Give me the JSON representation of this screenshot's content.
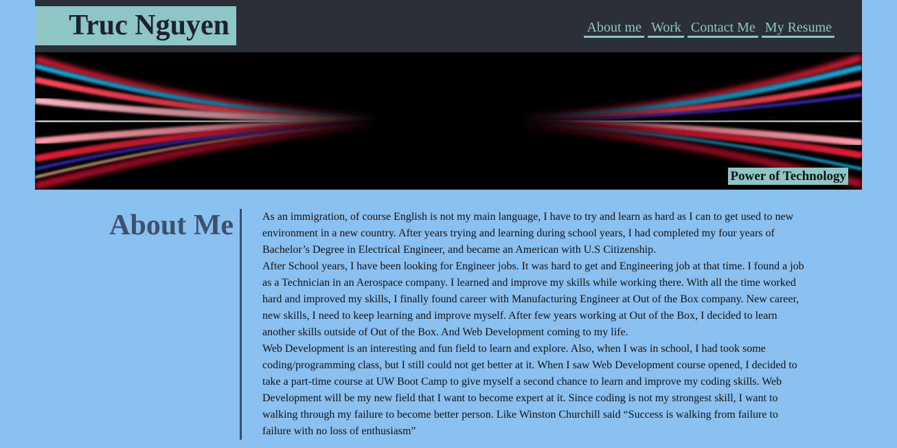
{
  "header": {
    "title": "Truc Nguyen",
    "nav": [
      {
        "label": "About me"
      },
      {
        "label": "Work"
      },
      {
        "label": "Contact Me"
      },
      {
        "label": "My Resume"
      }
    ]
  },
  "hero": {
    "caption": "Power of Technology"
  },
  "about": {
    "heading": "About Me",
    "paragraphs": [
      "As an immigration, of course English is not my main language, I have to try and learn as hard as I can to get used to new environment in a new country. After years trying and learning during school years, I had completed my four years of Bachelor’s Degree in Electrical Engineer, and became an American with U.S Citizenship.",
      "After School years, I have been looking for Engineer jobs. It was hard to get and Engineering job at that time. I found a job as a Technician in an Aerospace company. I learned and improve my skills while working there. With all the time worked hard and improved my skills, I finally found career with Manufacturing Engineer at Out of the Box company. New career, new skills, I need to keep learning and improve myself. After few years working at Out of the Box, I decided to learn another skills outside of Out of the Box. And Web Development coming to my life.",
      "Web Development is an interesting and fun field to learn and explore. Also, when I was in school, I had took some coding/programming class, but I still could not get better at it. When I saw Web Development course opened, I decided to take a part-time course at UW Boot Camp to give myself a second chance to learn and improve my coding skills. Web Development will be my new field that I want to become expert at it. Since coding is not my strongest skill, I want to walking through my failure to become better person. Like Winston Churchill said “Success is walking from failure to failure with no loss of enthusiasm”"
    ]
  },
  "colors": {
    "page_background": "#8ac0f0",
    "header_background": "#2b2f38",
    "accent_teal": "#8dc6c4",
    "heading_blue": "#3c5070"
  }
}
